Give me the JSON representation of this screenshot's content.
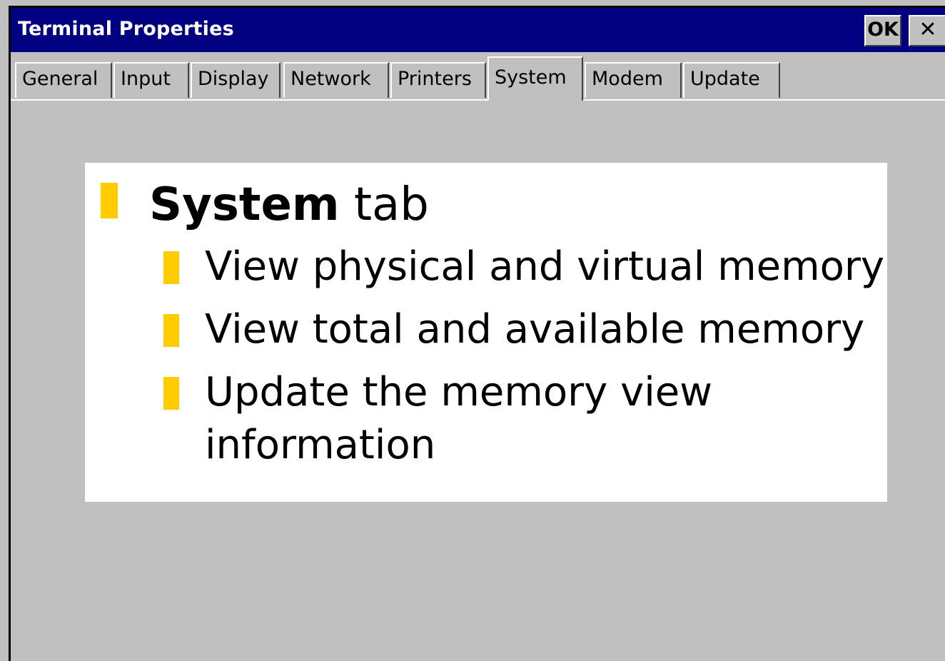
{
  "window": {
    "title": "Terminal Properties",
    "ok_label": "OK",
    "close_label": "✕"
  },
  "tabs": [
    {
      "label": "General"
    },
    {
      "label": "Input"
    },
    {
      "label": "Display"
    },
    {
      "label": "Network"
    },
    {
      "label": "Printers"
    },
    {
      "label": "System",
      "active": true
    },
    {
      "label": "Modem"
    },
    {
      "label": "Update"
    }
  ],
  "slide": {
    "heading_bold": "System",
    "heading_rest": " tab",
    "items": [
      "View physical and virtual memory",
      "View total and available memory",
      "Update the memory view",
      "information"
    ],
    "bullet_color": "#ffcc00"
  }
}
